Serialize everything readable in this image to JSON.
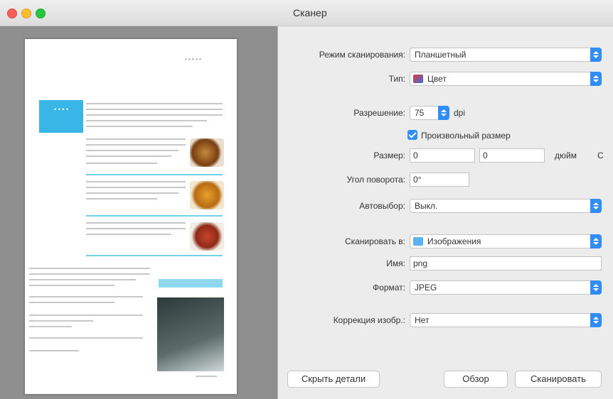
{
  "window": {
    "title": "Сканер"
  },
  "preview": {
    "header_text": "• • • • •",
    "tag_text": "• • • •"
  },
  "form": {
    "mode": {
      "label": "Режим сканирования:",
      "value": "Планшетный"
    },
    "type": {
      "label": "Тип:",
      "value": "Цвет",
      "icon": "color-swatch-icon"
    },
    "resolution": {
      "label": "Разрешение:",
      "value": "75",
      "unit": "dpi"
    },
    "custom_size": {
      "label": "Произвольный размер",
      "checked": true
    },
    "size": {
      "label": "Размер:",
      "width": "0",
      "height": "0",
      "unit": "дюйм",
      "extra": "С"
    },
    "rotation": {
      "label": "Угол поворота:",
      "value": "0°"
    },
    "autoselect": {
      "label": "Автовыбор:",
      "value": "Выкл."
    },
    "scan_to": {
      "label": "Сканировать в:",
      "value": "Изображения",
      "icon": "folder-icon"
    },
    "name": {
      "label": "Имя:",
      "value": "png"
    },
    "format": {
      "label": "Формат:",
      "value": "JPEG"
    },
    "correction": {
      "label": "Коррекция изобр.:",
      "value": "Нет"
    }
  },
  "buttons": {
    "hide_details": "Скрыть детали",
    "browse": "Обзор",
    "scan": "Сканировать"
  },
  "colors": {
    "accent": "#2f8df5"
  }
}
